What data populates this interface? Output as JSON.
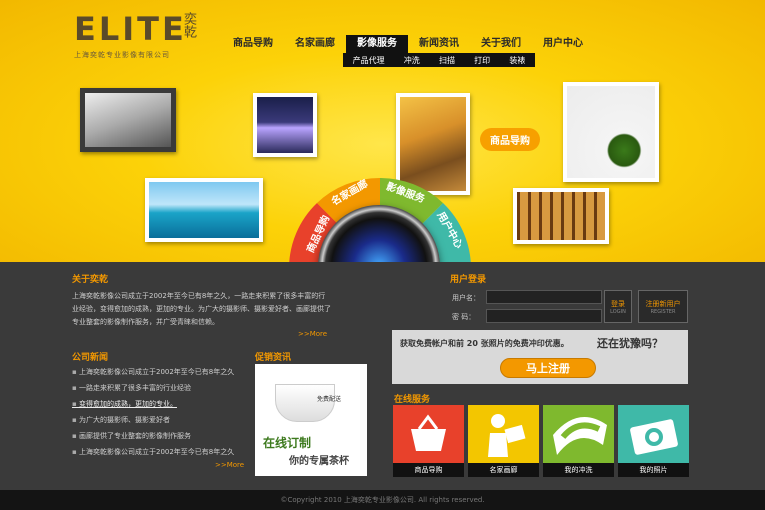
{
  "logo": {
    "main": "ELITE",
    "cn": "奕乾",
    "sub": "上海奕乾专业影像有限公司"
  },
  "nav": {
    "items": [
      "商品导购",
      "名家画廊",
      "影像服务",
      "新闻资讯",
      "关于我们",
      "用户中心"
    ],
    "active": "影像服务",
    "sub_items": [
      "产品代理",
      "冲洗",
      "扫描",
      "打印",
      "装裱"
    ]
  },
  "hero": {
    "tag": "商品导购",
    "wheel": [
      "商品导购",
      "名家画廊",
      "影像服务",
      "用户中心"
    ],
    "wheel_colors": [
      "#e8412b",
      "#f39800",
      "#7fb92e",
      "#3fb9a8"
    ]
  },
  "about": {
    "title": "关于奕乾",
    "text": "上海奕乾影像公司成立于2002年至今已有8年之久，一路走来积累了很多丰富的行业经验，变得愈加的成熟，更加的专业。为广大的摄影师、摄影爱好者、画廊提供了专业整套的影像制作服务，并广受青睐和信赖。",
    "more": ">>More"
  },
  "news": {
    "title": "公司新闻",
    "items": [
      "上海奕乾影像公司成立于2002年至今已有8年之久",
      "一路走来积累了很多丰富的行业经验",
      "变得愈加的成熟，更加的专业。",
      "为广大的摄影师、摄影爱好者",
      "画廊提供了专业整套的影像制作服务",
      "上海奕乾影像公司成立于2002年至今已有8年之久"
    ],
    "more": ">>More"
  },
  "promo": {
    "title": "促销资讯",
    "tag": "免费配送",
    "big": "在线订制",
    "small": "你的专属茶杯"
  },
  "login": {
    "title": "用户登录",
    "user_label": "用户名：",
    "pass_label": "密  码：",
    "login_btn": "登录",
    "login_btn_en": "LOGIN",
    "reg_btn": "注册新用户",
    "reg_btn_en": "REGISTER"
  },
  "register": {
    "text": "获取免费帐户和前 20 张照片的免费冲印优惠。",
    "question": "还在犹豫吗？",
    "button": "马上注册"
  },
  "services": {
    "title": "在线服务",
    "items": [
      {
        "label": "商品导购",
        "color": "#e8412b",
        "icon": "basket-icon"
      },
      {
        "label": "名家画廊",
        "color": "#f3c600",
        "icon": "person-reading-icon"
      },
      {
        "label": "我的冲洗",
        "color": "#7fb92e",
        "icon": "film-icon"
      },
      {
        "label": "我的照片",
        "color": "#3fb9a8",
        "icon": "camera-icon"
      }
    ]
  },
  "footer": {
    "text": "©Copyright 2010  上海奕乾专业影像公司. All rights reserved."
  }
}
